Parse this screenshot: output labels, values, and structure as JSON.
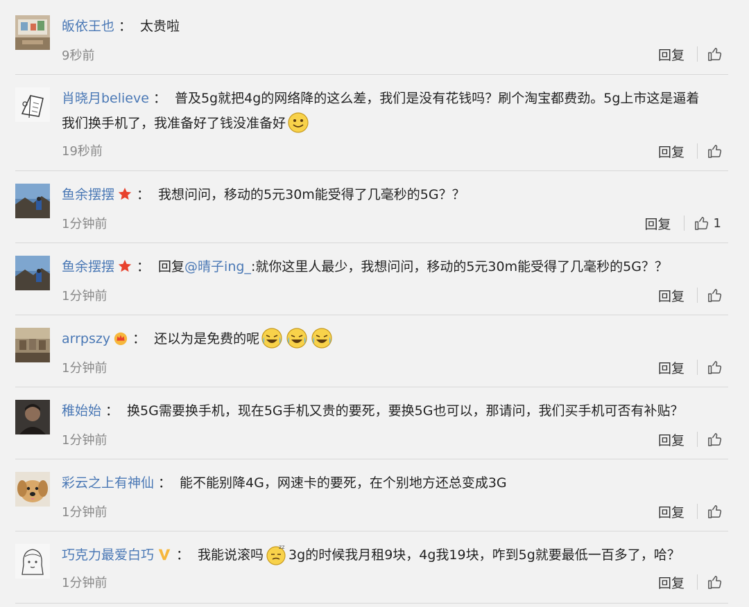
{
  "actions": {
    "reply_label": "回复"
  },
  "comments": [
    {
      "user": "皈依王也",
      "colon": "：",
      "text": "太贵啦",
      "time": "9秒前"
    },
    {
      "user": "肖晓月believe",
      "colon": "：",
      "text": "普及5g就把4g的网络降的这么差，我们是没有花钱吗？刷个淘宝都费劲。5g上市这是逼着",
      "text2": "我们换手机了，我准备好了钱没准备好",
      "time": "19秒前"
    },
    {
      "user": "鱼余摆摆",
      "badge": "red-star-badge",
      "colon": "：",
      "text": "我想问问，移动的5元30m能受得了几毫秒的5G？？",
      "time": "1分钟前",
      "likes": "1"
    },
    {
      "user": "鱼余摆摆",
      "badge": "red-star-badge",
      "colon": "：",
      "text_prefix": "回复",
      "mention": "@晴子ing_",
      "text": ":就你这里人最少，我想问问，移动的5元30m能受得了几毫秒的5G？？",
      "time": "1分钟前"
    },
    {
      "user": "arrpszy",
      "badge": "crown-badge",
      "colon": "：",
      "text": "还以为是免费的呢",
      "emoji": "laugh-cry-emoji",
      "time": "1分钟前"
    },
    {
      "user": "稚始始",
      "colon": "：",
      "text": "换5G需要换手机，现在5G手机又贵的要死，要换5G也可以，那请问，我们买手机可否有补贴？",
      "time": "1分钟前"
    },
    {
      "user": "彩云之上有神仙",
      "colon": "：",
      "text": "能不能别降4G，网速卡的要死，在个别地方还总变成3G",
      "time": "1分钟前"
    },
    {
      "user": "巧克力最爱白巧",
      "badge": "v-badge",
      "colon": "：",
      "text_prefix": "我能说滚吗",
      "emoji": "sleepy-emoji",
      "text": "3g的时候我月租9块，4g我19块，咋到5g就要最低一百多了，哈？",
      "time": "1分钟前"
    }
  ],
  "colors": {
    "username": "#4a78b5",
    "text": "#222222",
    "time": "#888888",
    "background": "#f2f2f2"
  }
}
